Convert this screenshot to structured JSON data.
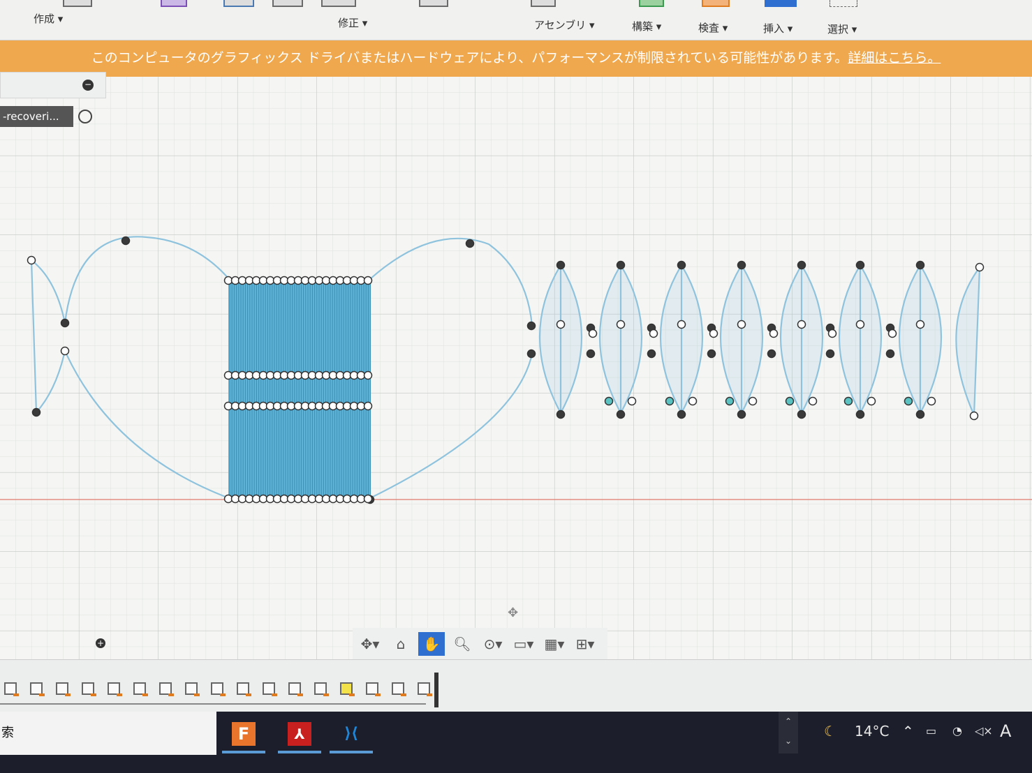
{
  "ribbon": {
    "groups": [
      {
        "label": "作成 ▾"
      },
      {
        "label": "修正 ▾"
      },
      {
        "label": "アセンブリ ▾"
      },
      {
        "label": "構築 ▾"
      },
      {
        "label": "検査 ▾"
      },
      {
        "label": "挿入 ▾"
      },
      {
        "label": "選択 ▾"
      }
    ]
  },
  "banner": {
    "message": "このコンピュータのグラフィックス ドライバまたはハードウェアにより、パフォーマンスが制限されている可能性があります。",
    "link": "詳細はこちら。"
  },
  "browser": {
    "tab_label": "-recoveri..."
  },
  "navbar": {
    "items": [
      {
        "icon": "orbit-icon",
        "label": "✥▾"
      },
      {
        "icon": "look-at-icon",
        "label": "⌂"
      },
      {
        "icon": "pan-hand-icon",
        "label": "✋",
        "active": true
      },
      {
        "icon": "zoom-icon",
        "label": "🔍︎"
      },
      {
        "icon": "fit-icon",
        "label": "⊙▾"
      },
      {
        "icon": "display-icon",
        "label": "▭▾"
      },
      {
        "icon": "grid-icon",
        "label": "▦▾"
      },
      {
        "icon": "viewports-icon",
        "label": "⊞▾"
      }
    ]
  },
  "timeline": {
    "count": 17
  },
  "taskbar": {
    "search_text": "索",
    "apps": [
      {
        "name": "fusion-360-icon",
        "glyph": "F",
        "color": "#e9742b"
      },
      {
        "name": "acrobat-icon",
        "glyph": "⅄",
        "color": "#c8201e"
      },
      {
        "name": "vscode-icon",
        "glyph": "⟩⟨",
        "color": "#1f86d8"
      }
    ],
    "weather": "14°C"
  },
  "colors": {
    "banner": "#f0a84e",
    "sketch": "#8fc3dd",
    "fill": "#5fb3d6"
  }
}
